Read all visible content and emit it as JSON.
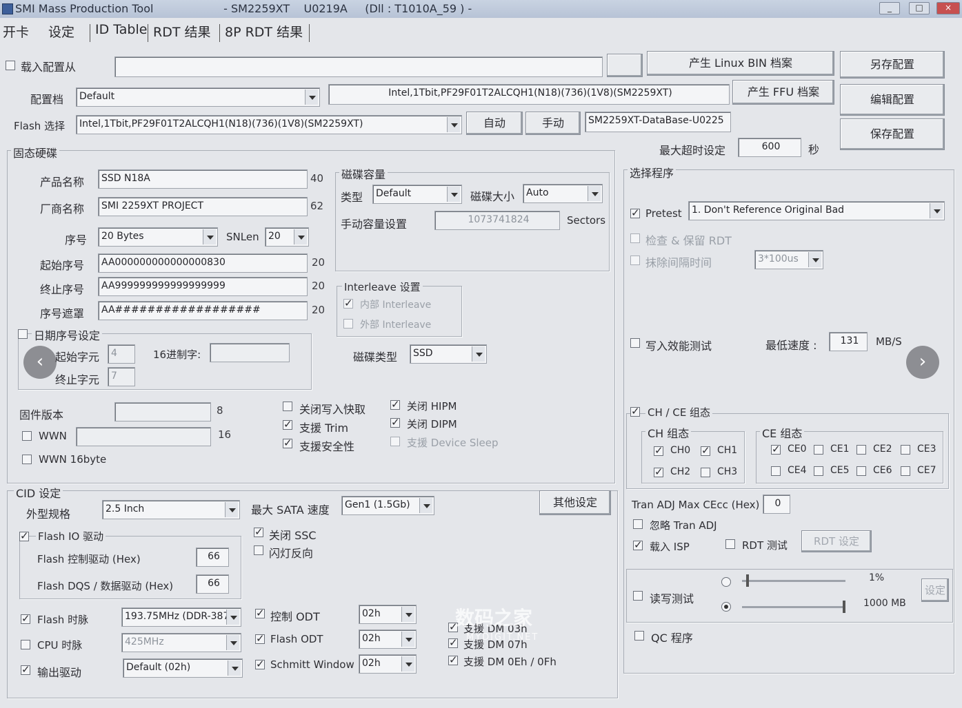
{
  "window": {
    "title": "SMI Mass Production Tool                    - SM2259XT    U0219A     (Dll : T1010A_59 ) -"
  },
  "menu": {
    "items": [
      "开卡",
      "设定",
      "ID Table",
      "RDT 结果",
      "8P RDT 结果"
    ]
  },
  "top": {
    "load_config_label": "载入配置从",
    "load_config_path": "",
    "config_label": "配置档",
    "config_value": "Default",
    "config_desc": "Intel,1Tbit,PF29F01T2ALCQH1(N18)(736)(1V8)(SM2259XT)",
    "flash_select_label": "Flash 选择",
    "flash_select_value": "Intel,1Tbit,PF29F01T2ALCQH1(N18)(736)(1V8)(SM2259XT)",
    "auto_button": "自动",
    "manual_button": "手动",
    "database_value": "SM2259XT-DataBase-U0225",
    "gen_linux_bin_button": "产生 Linux BIN 档案",
    "gen_ffu_button": "产生 FFU 档案",
    "save_as_button": "另存配置",
    "edit_config_button": "编辑配置",
    "save_config_button": "保存配置",
    "timeout_label": "最大超时设定",
    "timeout_value": "600",
    "timeout_unit": "秒"
  },
  "ssd": {
    "group_title": "固态硬碟",
    "product_name_label": "产品名称",
    "product_name_value": "SSD N18A",
    "product_name_max": "40",
    "vendor_label": "厂商名称",
    "vendor_value": "SMI 2259XT PROJECT",
    "vendor_max": "62",
    "serial_label": "序号",
    "serial_value": "20 Bytes",
    "snlen_label": "SNLen",
    "snlen_value": "20",
    "start_sn_label": "起始序号",
    "start_sn_value": "AA000000000000000830",
    "start_sn_len": "20",
    "end_sn_label": "终止序号",
    "end_sn_value": "AA999999999999999999",
    "end_sn_len": "20",
    "sn_mask_label": "序号遮罩",
    "sn_mask_value": "AA##################",
    "sn_mask_len": "20",
    "date_sn_label": "日期序号设定",
    "start_char_label": "起始字元",
    "start_char_value": "4",
    "hex_label": "16进制字:",
    "hex_value": "",
    "end_char_label": "终止字元",
    "end_char_value": "7",
    "fw_version_label": "固件版本",
    "fw_version_value": "",
    "fw_version_max": "8",
    "wwn_label": "WWN",
    "wwn_value": "",
    "wwn_max": "16",
    "wwn16_label": "WWN 16byte"
  },
  "capacity": {
    "group_title": "磁碟容量",
    "type_label": "类型",
    "type_value": "Default",
    "size_label": "磁碟大小",
    "size_value": "Auto",
    "manual_label": "手动容量设置",
    "manual_value": "1073741824",
    "sectors_label": "Sectors"
  },
  "interleave": {
    "group_title": "Interleave 设置",
    "internal_label": "内部 Interleave",
    "external_label": "外部 Interleave",
    "disk_type_label": "磁碟类型",
    "disk_type_value": "SSD"
  },
  "features": {
    "disable_write_cache": "关闭写入快取",
    "support_trim": "支援 Trim",
    "support_security": "支援安全性",
    "disable_hipm": "关闭 HIPM",
    "disable_dipm": "关闭 DIPM",
    "support_device_sleep": "支援 Device Sleep"
  },
  "cid": {
    "group_title": "CID 设定",
    "form_factor_label": "外型规格",
    "form_factor_value": "2.5 Inch",
    "max_sata_label": "最大 SATA 速度",
    "max_sata_value": "Gen1 (1.5Gb)",
    "other_button": "其他设定",
    "flash_io_label": "Flash IO 驱动",
    "flash_ctrl_label": "Flash 控制驱动 (Hex)",
    "flash_ctrl_value": "66",
    "flash_dqs_label": "Flash DQS / 数据驱动 (Hex)",
    "flash_dqs_value": "66",
    "disable_ssc": "关闭 SSC",
    "led_reverse": "闪灯反向",
    "flash_clock_label": "Flash 时脉",
    "flash_clock_value": "193.75MHz (DDR-387",
    "cpu_clock_label": "CPU 时脉",
    "cpu_clock_value": "425MHz",
    "output_drive_label": "输出驱动",
    "output_drive_value": "Default (02h)",
    "ctrl_odt_label": "控制 ODT",
    "ctrl_odt_value": "02h",
    "flash_odt_label": "Flash ODT",
    "flash_odt_value": "02h",
    "schmitt_label": "Schmitt Window",
    "schmitt_value": "02h",
    "dm03_label": "支援 DM 03h",
    "dm07_label": "支援 DM 07h",
    "dm0e_label": "支援 DM 0Eh / 0Fh"
  },
  "program": {
    "group_title": "选择程序",
    "pretest_label": "Pretest",
    "pretest_value": "1. Don't Reference Original Bad",
    "check_rdt_label": "检查 & 保留 RDT",
    "erase_interval_label": "抹除间隔时间",
    "erase_interval_value": "3*100us",
    "write_perf_label": "写入效能测试",
    "min_speed_label": "最低速度 :",
    "min_speed_value": "131",
    "min_speed_unit": "MB/S",
    "chce_label": "CH / CE 组态",
    "ch_group_title": "CH 组态",
    "ch": [
      "CH0",
      "CH1",
      "CH2",
      "CH3"
    ],
    "ce_group_title": "CE 组态",
    "ce": [
      "CE0",
      "CE1",
      "CE2",
      "CE3",
      "CE4",
      "CE5",
      "CE6",
      "CE7"
    ],
    "tran_adj_label": "Tran ADJ Max CEcc (Hex)",
    "tran_adj_value": "0",
    "ignore_tran_adj_label": "忽略 Tran ADJ",
    "load_isp_label": "载入 ISP",
    "rdt_test_label": "RDT 测试",
    "rdt_setting_button": "RDT 设定",
    "rw_test_label": "读写测试",
    "percent_value": "1%",
    "mb_value": "1000 MB",
    "setting_button": "设定",
    "qc_label": "QC 程序"
  },
  "overlay": {
    "prev": "‹",
    "next": "›",
    "watermark": "数码之家",
    "watermark_sub": "MYDIGIT.NET"
  },
  "colors": {
    "background": "#e4e6ea",
    "titlebar": "#b7c3d6",
    "field": "#f4f5f7"
  }
}
